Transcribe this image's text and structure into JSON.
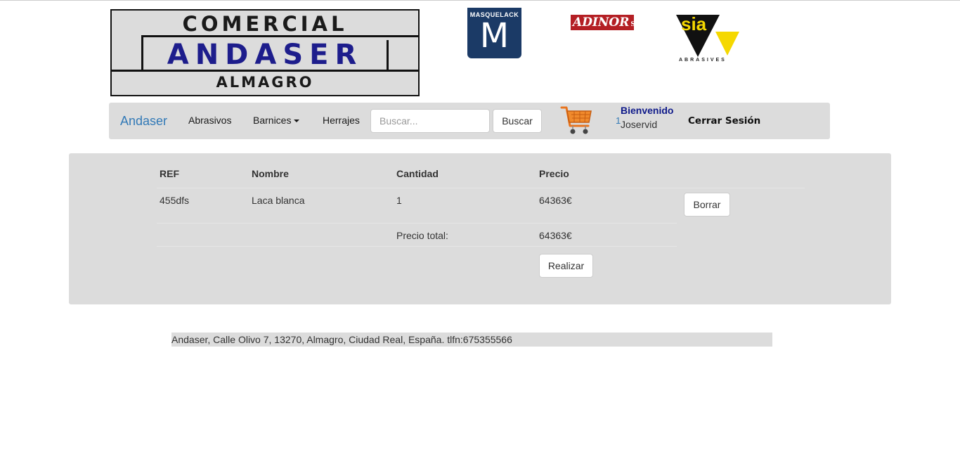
{
  "logos": {
    "main": {
      "line1": "COMERCIAL",
      "line2": "ANDASER",
      "line3": "ALMAGRO"
    },
    "masquelack": {
      "label": "MASQUELACK",
      "letter": "M"
    },
    "adinor": {
      "name": "ADINOR",
      "suffix": "S.L"
    },
    "sia": {
      "name": "sia",
      "tagline": "ABRASIVES"
    }
  },
  "navbar": {
    "brand": "Andaser",
    "links": [
      "Abrasivos",
      "Barnices",
      "Herrajes"
    ],
    "search_placeholder": "Buscar...",
    "search_button": "Buscar",
    "cart_icon": "shopping-cart-icon",
    "cart_count": "1",
    "welcome": "Bienvenido",
    "username": "Joservid",
    "logout": "Cerrar Sesión"
  },
  "cart": {
    "headers": [
      "REF",
      "Nombre",
      "Cantidad",
      "Precio"
    ],
    "rows": [
      {
        "ref": "455dfs",
        "nombre": "Laca blanca",
        "cantidad": "1",
        "precio": "64363€",
        "action": "Borrar"
      }
    ],
    "total_label": "Precio total:",
    "total_value": "64363€",
    "submit_button": "Realizar"
  },
  "footer": {
    "text": "Andaser, Calle Olivo 7, 13270, Almagro, Ciudad Real, España. tlfn:675355566"
  },
  "colors": {
    "brand_blue": "#337ab7",
    "panel_gray": "#dcdcdc",
    "welcome_blue": "#0f1a8a",
    "cart_orange": "#e8741e"
  }
}
